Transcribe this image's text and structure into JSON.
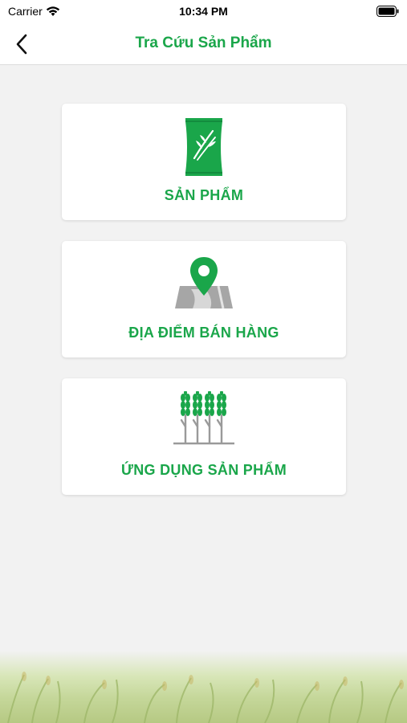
{
  "status_bar": {
    "carrier": "Carrier",
    "time": "10:34 PM"
  },
  "nav": {
    "title": "Tra Cứu Sản Phẩm",
    "back_icon": "chevron-left-icon"
  },
  "cards": [
    {
      "label": "SẢN PHẨM",
      "icon": "product-bag-icon"
    },
    {
      "label": "ĐỊA ĐIỂM BÁN HÀNG",
      "icon": "map-pin-icon"
    },
    {
      "label": "ỨNG DỤNG SẢN PHẨM",
      "icon": "rice-plant-icon"
    }
  ],
  "colors": {
    "brand_green": "#1aa64a",
    "background": "#f2f2f2",
    "card": "#ffffff",
    "map_gray": "#a6a6a6"
  }
}
